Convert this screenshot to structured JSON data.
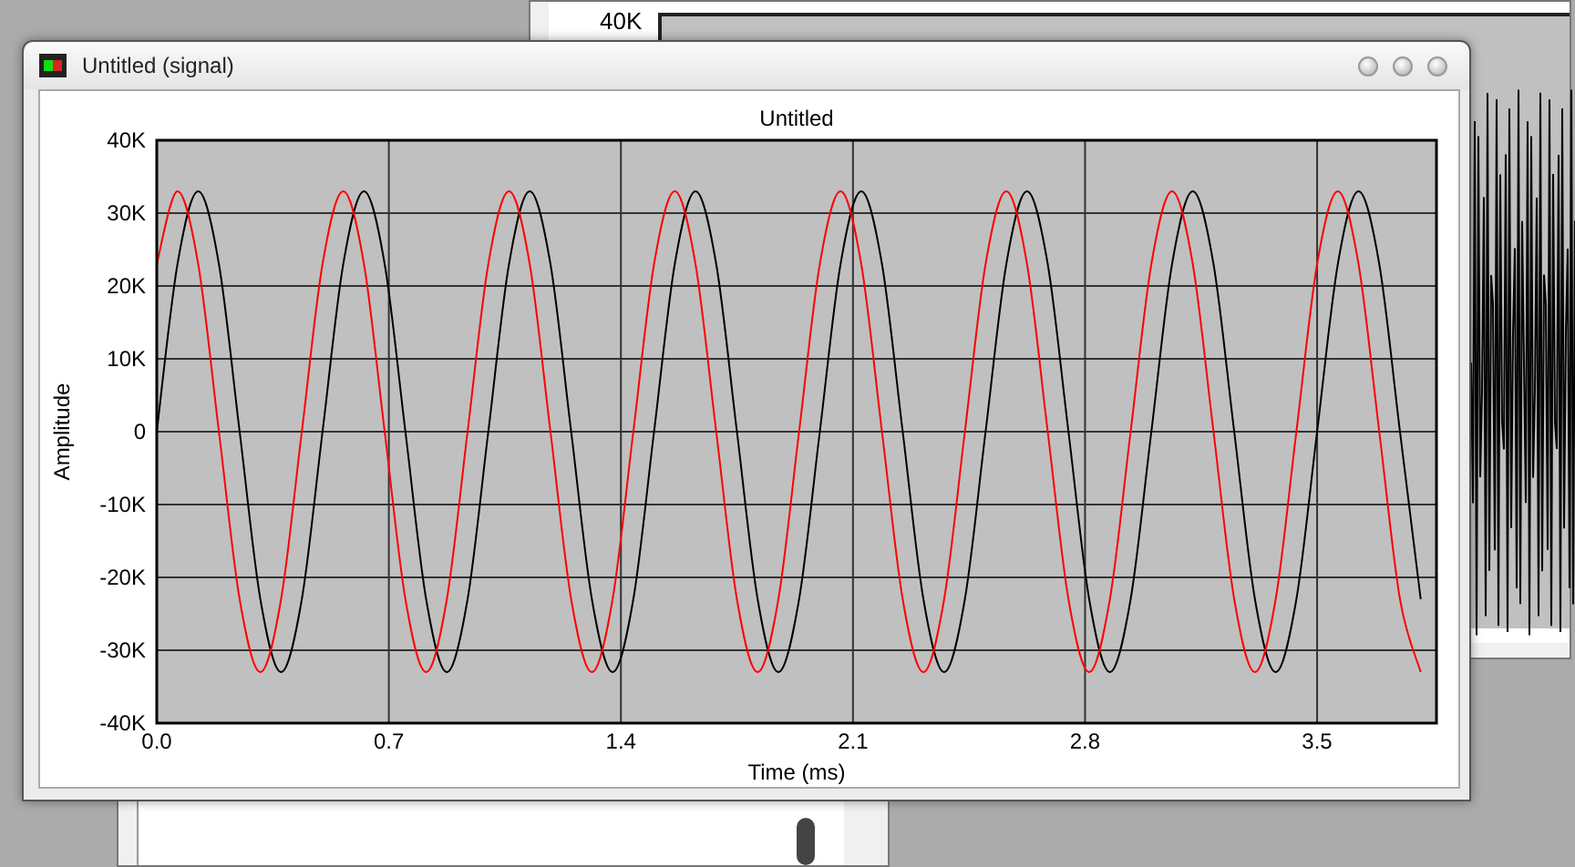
{
  "background_window": {
    "axis_label": "40K"
  },
  "window": {
    "title": "Untitled (signal)"
  },
  "chart_data": {
    "type": "line",
    "title": "Untitled",
    "xlabel": "Time (ms)",
    "ylabel": "Amplitude",
    "grid": true,
    "x": [
      0,
      0.0625,
      0.125,
      0.1875,
      0.25,
      0.3125,
      0.375,
      0.4375,
      0.5,
      0.5625,
      0.625,
      0.6875,
      0.75,
      0.8125,
      0.875,
      0.9375,
      1,
      1.0625,
      1.125,
      1.1875,
      1.25,
      1.3125,
      1.375,
      1.4375,
      1.5,
      1.5625,
      1.625,
      1.6875,
      1.75,
      1.8125,
      1.875,
      1.9375,
      2,
      2.0625,
      2.125,
      2.1875,
      2.25,
      2.3125,
      2.375,
      2.4375,
      2.5,
      2.5625,
      2.625,
      2.6875,
      2.75,
      2.8125,
      2.875,
      2.9375,
      3,
      3.0625,
      3.125,
      3.1875,
      3.25,
      3.3125,
      3.375,
      3.4375,
      3.5,
      3.5625,
      3.625,
      3.6875,
      3.75,
      3.8125
    ],
    "series": [
      {
        "color": "#000000",
        "values": [
          0,
          23000,
          33000,
          23000,
          0,
          -23000,
          -33000,
          -23000,
          0,
          23000,
          33000,
          23000,
          0,
          -23000,
          -33000,
          -23000,
          0,
          23000,
          33000,
          23000,
          0,
          -23000,
          -33000,
          -23000,
          0,
          23000,
          33000,
          23000,
          0,
          -23000,
          -33000,
          -23000,
          0,
          23000,
          33000,
          23000,
          0,
          -23000,
          -33000,
          -23000,
          0,
          23000,
          33000,
          23000,
          0,
          -23000,
          -33000,
          -23000,
          0,
          23000,
          33000,
          23000,
          0,
          -23000,
          -33000,
          -23000,
          0,
          23000,
          33000,
          23000,
          0,
          -23000
        ]
      },
      {
        "color": "#ff0000",
        "values": [
          23000,
          33000,
          23000,
          0,
          -23000,
          -33000,
          -23000,
          0,
          23000,
          33000,
          23000,
          0,
          -23000,
          -33000,
          -23000,
          0,
          23000,
          33000,
          23000,
          0,
          -23000,
          -33000,
          -23000,
          0,
          23000,
          33000,
          23000,
          0,
          -23000,
          -33000,
          -23000,
          0,
          23000,
          33000,
          23000,
          0,
          -23000,
          -33000,
          -23000,
          0,
          23000,
          33000,
          23000,
          0,
          -23000,
          -33000,
          -23000,
          0,
          23000,
          33000,
          23000,
          0,
          -23000,
          -33000,
          -23000,
          0,
          23000,
          33000,
          23000,
          0,
          -23000,
          -33000
        ]
      }
    ],
    "xlim": [
      0,
      3.86
    ],
    "ylim": [
      -40000,
      40000
    ],
    "xticks": [
      {
        "value": 0,
        "label": "0.0"
      },
      {
        "value": 0.7,
        "label": "0.7"
      },
      {
        "value": 1.4,
        "label": "1.4"
      },
      {
        "value": 2.1,
        "label": "2.1"
      },
      {
        "value": 2.8,
        "label": "2.8"
      },
      {
        "value": 3.5,
        "label": "3.5"
      }
    ],
    "yticks": [
      {
        "value": -40000,
        "label": "-40K"
      },
      {
        "value": -30000,
        "label": "-30K"
      },
      {
        "value": -20000,
        "label": "-20K"
      },
      {
        "value": -10000,
        "label": "-10K"
      },
      {
        "value": 0,
        "label": "0"
      },
      {
        "value": 10000,
        "label": "10K"
      },
      {
        "value": 20000,
        "label": "20K"
      },
      {
        "value": 30000,
        "label": "30K"
      },
      {
        "value": 40000,
        "label": "40K"
      }
    ]
  }
}
